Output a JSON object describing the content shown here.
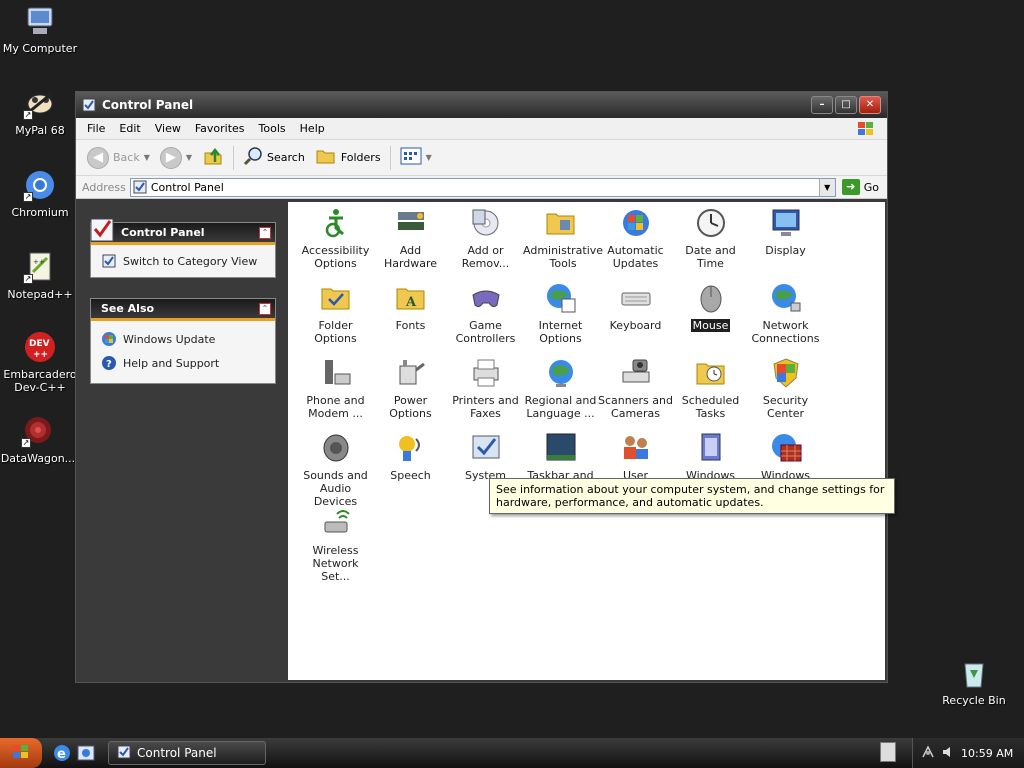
{
  "desktop": {
    "icons": [
      {
        "label": "My Computer",
        "icon": "my-computer-icon"
      },
      {
        "label": "MyPal 68",
        "icon": "mypal-icon"
      },
      {
        "label": "Chromium",
        "icon": "chromium-icon"
      },
      {
        "label": "Notepad++",
        "icon": "notepadpp-icon"
      },
      {
        "label": "Embarcadero Dev-C++",
        "icon": "devcpp-icon"
      },
      {
        "label": "DataWagon...",
        "icon": "datawagon-icon"
      },
      {
        "label": "Recycle Bin",
        "icon": "recycle-bin-icon"
      }
    ]
  },
  "window": {
    "title": "Control Panel",
    "controls": {
      "minimize": "–",
      "maximize": "□",
      "close": "✕"
    }
  },
  "menu": [
    "File",
    "Edit",
    "View",
    "Favorites",
    "Tools",
    "Help"
  ],
  "toolbar": {
    "back": "Back",
    "search": "Search",
    "folders": "Folders"
  },
  "address": {
    "label": "Address",
    "value": "Control Panel",
    "go": "Go"
  },
  "sidebar": {
    "control_panel": {
      "title": "Control Panel",
      "link": "Switch to Category View"
    },
    "see_also": {
      "title": "See Also",
      "links": [
        "Windows Update",
        "Help and Support"
      ]
    }
  },
  "items": [
    {
      "label": "Accessibility Options",
      "icon": "accessibility-icon"
    },
    {
      "label": "Add Hardware",
      "icon": "add-hardware-icon"
    },
    {
      "label": "Add or Remov...",
      "icon": "add-remove-icon"
    },
    {
      "label": "Administrative Tools",
      "icon": "admin-tools-icon"
    },
    {
      "label": "Automatic Updates",
      "icon": "automatic-updates-icon"
    },
    {
      "label": "Date and Time",
      "icon": "date-time-icon"
    },
    {
      "label": "Display",
      "icon": "display-icon"
    },
    {
      "label": "Folder Options",
      "icon": "folder-options-icon"
    },
    {
      "label": "Fonts",
      "icon": "fonts-icon"
    },
    {
      "label": "Game Controllers",
      "icon": "game-controllers-icon"
    },
    {
      "label": "Internet Options",
      "icon": "internet-options-icon"
    },
    {
      "label": "Keyboard",
      "icon": "keyboard-icon"
    },
    {
      "label": "Mouse",
      "icon": "mouse-icon"
    },
    {
      "label": "Network Connections",
      "icon": "network-icon"
    },
    {
      "label": "Phone and Modem ...",
      "icon": "phone-modem-icon"
    },
    {
      "label": "Power Options",
      "icon": "power-icon"
    },
    {
      "label": "Printers and Faxes",
      "icon": "printers-icon"
    },
    {
      "label": "Regional and Language ...",
      "icon": "regional-icon"
    },
    {
      "label": "Scanners and Cameras",
      "icon": "scanners-icon"
    },
    {
      "label": "Scheduled Tasks",
      "icon": "scheduled-tasks-icon"
    },
    {
      "label": "Security Center",
      "icon": "security-center-icon"
    },
    {
      "label": "Sounds and Audio Devices",
      "icon": "sounds-icon"
    },
    {
      "label": "Speech",
      "icon": "speech-icon"
    },
    {
      "label": "System",
      "icon": "system-icon"
    },
    {
      "label": "Taskbar and",
      "icon": "taskbar-icon"
    },
    {
      "label": "User Accounts",
      "icon": "user-accounts-icon"
    },
    {
      "label": "Windows",
      "icon": "windows-cardspace-icon"
    },
    {
      "label": "Windows",
      "icon": "windows-firewall-icon"
    },
    {
      "label": "Wireless Network Set...",
      "icon": "wireless-icon"
    }
  ],
  "selected_item": "Mouse",
  "tooltip": "See information about your computer system, and change settings for hardware, performance, and automatic updates.",
  "taskbar": {
    "task_label": "Control Panel",
    "clock": "10:59 AM"
  }
}
